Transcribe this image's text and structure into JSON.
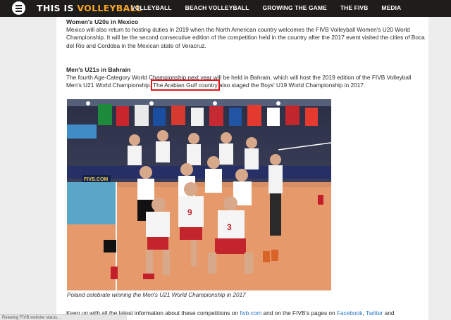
{
  "brand": {
    "part1": "THIS IS ",
    "part2": "VOLLEYBALL"
  },
  "nav": [
    "VOLLEYBALL",
    "BEACH VOLLEYBALL",
    "GROWING THE GAME",
    "THE FIVB",
    "MEDIA"
  ],
  "article": {
    "section1": {
      "heading": "Women's U20s in Mexico",
      "text": "Mexico will also return to hosting duties in 2019 when the North American country welcomes the FIVB Volleyball Women's U20 World Championship. It will be the second consecutive edition of the competition held in the country after the 2017 event visited the cities of Boca del Rio and Cordoba in the Mexican state of Veracruz."
    },
    "section2": {
      "heading": "Men's U21s in Bahrain",
      "text_before": "The fourth Age-Category World Championship next year will be held in Bahrain, which will host the 2019 edition of the  FIVB Volleyball Men's U21 World Championship. ",
      "highlight": "The Arabian Gulf country",
      "text_after": " also staged the Boys' U19 World Championship in 2017."
    },
    "photo": {
      "board_text": "FIVB.COM",
      "jersey_numbers": [
        "9",
        "3"
      ]
    },
    "caption": "Poland celebrate winning the Men's U21 World Championship in 2017",
    "footer": {
      "t1": "Keep up with all the latest information about these competitions on ",
      "link1": "fivb.com",
      "t2": " and on the FIVB's pages on ",
      "link2": "Facebook",
      "t3": ", ",
      "link3": "Twitter",
      "t4": " and"
    }
  },
  "status": "Relaxing FIVB website status..."
}
